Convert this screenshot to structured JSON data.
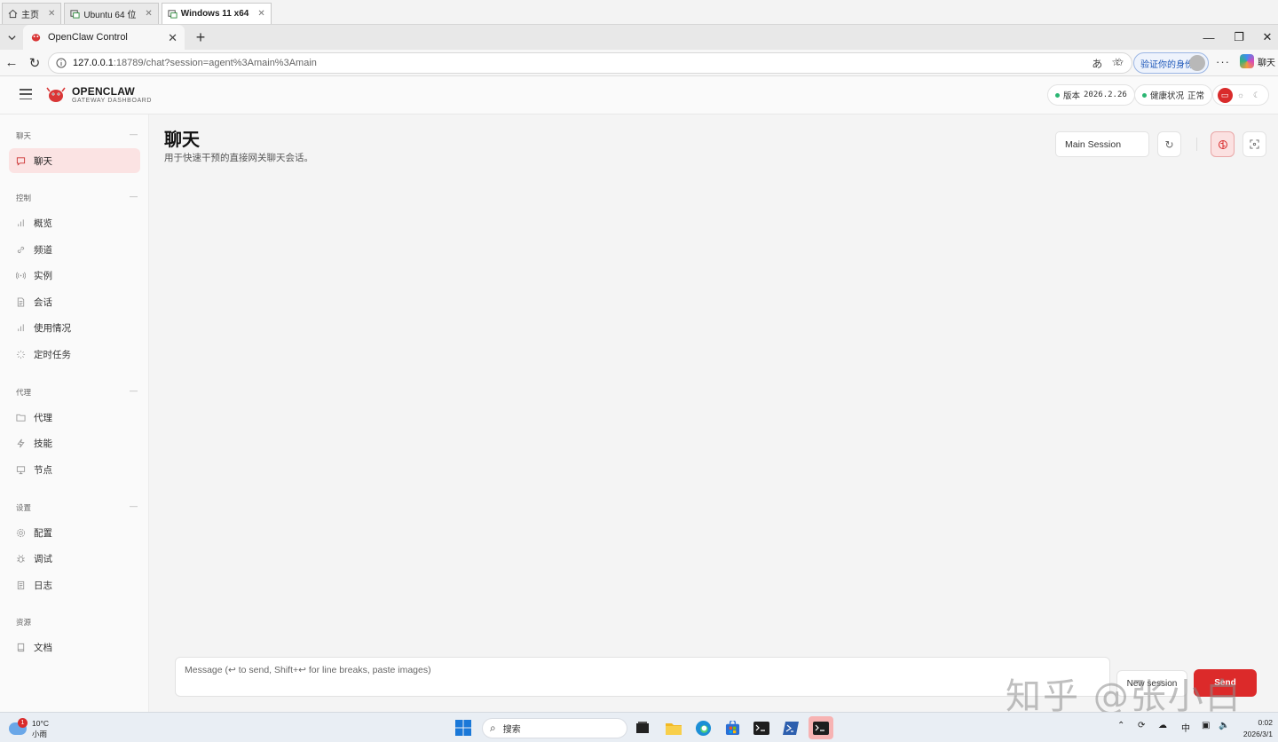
{
  "vm_tabs": [
    {
      "label": "主页",
      "icon": "home-icon",
      "active": false
    },
    {
      "label": "Ubuntu 64 位",
      "icon": "vm-icon",
      "active": false
    },
    {
      "label": "Windows 11 x64",
      "icon": "vm-icon",
      "active": true
    }
  ],
  "browser": {
    "tab_title": "OpenClaw Control",
    "url_host": "127.0.0.1",
    "url_path": ":18789/chat?session=agent%3Amain%3Amain",
    "profile_label": "验证你的身份",
    "copilot_label": "聊天"
  },
  "header": {
    "brand_name": "OPENCLAW",
    "brand_sub": "GATEWAY DASHBOARD",
    "version_label": "版本",
    "version_value": "2026.2.26",
    "health_label": "健康状况",
    "health_value": "正常",
    "status_color": "#2bb673",
    "accent_color": "#d92b2b"
  },
  "sidebar": {
    "sections": [
      {
        "title": "聊天",
        "items": [
          {
            "label": "聊天",
            "icon": "chat-icon",
            "active": true
          }
        ]
      },
      {
        "title": "控制",
        "items": [
          {
            "label": "概览",
            "icon": "bar-chart-icon"
          },
          {
            "label": "频道",
            "icon": "link-icon"
          },
          {
            "label": "实例",
            "icon": "broadcast-icon"
          },
          {
            "label": "会话",
            "icon": "document-icon"
          },
          {
            "label": "使用情况",
            "icon": "bar-chart-icon"
          },
          {
            "label": "定时任务",
            "icon": "loader-icon"
          }
        ]
      },
      {
        "title": "代理",
        "items": [
          {
            "label": "代理",
            "icon": "folder-icon"
          },
          {
            "label": "技能",
            "icon": "lightning-icon"
          },
          {
            "label": "节点",
            "icon": "monitor-icon"
          }
        ]
      },
      {
        "title": "设置",
        "items": [
          {
            "label": "配置",
            "icon": "gear-icon"
          },
          {
            "label": "调试",
            "icon": "bug-icon"
          },
          {
            "label": "日志",
            "icon": "log-icon"
          }
        ]
      },
      {
        "title": "资源",
        "items": [
          {
            "label": "文档",
            "icon": "book-icon"
          }
        ]
      }
    ]
  },
  "main": {
    "title": "聊天",
    "subtitle": "用于快速干预的直接网关聊天会话。",
    "session_selected": "Main Session",
    "composer_placeholder": "Message (↩ to send, Shift+↩ for line breaks, paste images)",
    "new_session_label": "New session",
    "send_label": "Send"
  },
  "watermark": "知乎 @张小白",
  "taskbar": {
    "weather_temp": "10°C",
    "weather_cond": "小雨",
    "weather_badge": "1",
    "search_label": "搜索",
    "ime": "中",
    "time": "0:02",
    "date": "2026/3/1"
  }
}
